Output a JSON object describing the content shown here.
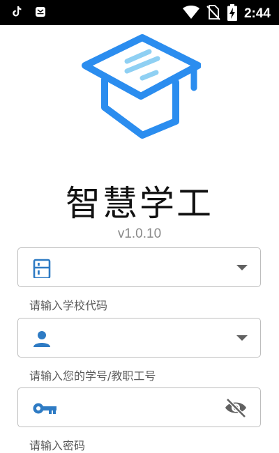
{
  "status_bar": {
    "time": "2:44",
    "icons": [
      "tiktok-icon",
      "notification-icon",
      "wifi-icon",
      "no-sim-icon",
      "battery-charging-icon"
    ]
  },
  "app": {
    "title": "智慧学工",
    "version": "v1.0.10",
    "logo_icon": "graduation-cap-icon",
    "accent_color": "#1e88e5"
  },
  "form": {
    "school_code": {
      "value": "",
      "hint": "请输入学校代码",
      "icon": "school-building-icon",
      "trailing_icon": "dropdown-arrow-icon"
    },
    "user_id": {
      "value": "",
      "hint": "请输入您的学号/教职工号",
      "icon": "person-icon",
      "trailing_icon": "dropdown-arrow-icon"
    },
    "password": {
      "value": "",
      "hint": "请输入密码",
      "icon": "key-icon",
      "trailing_icon": "eye-off-icon"
    }
  }
}
